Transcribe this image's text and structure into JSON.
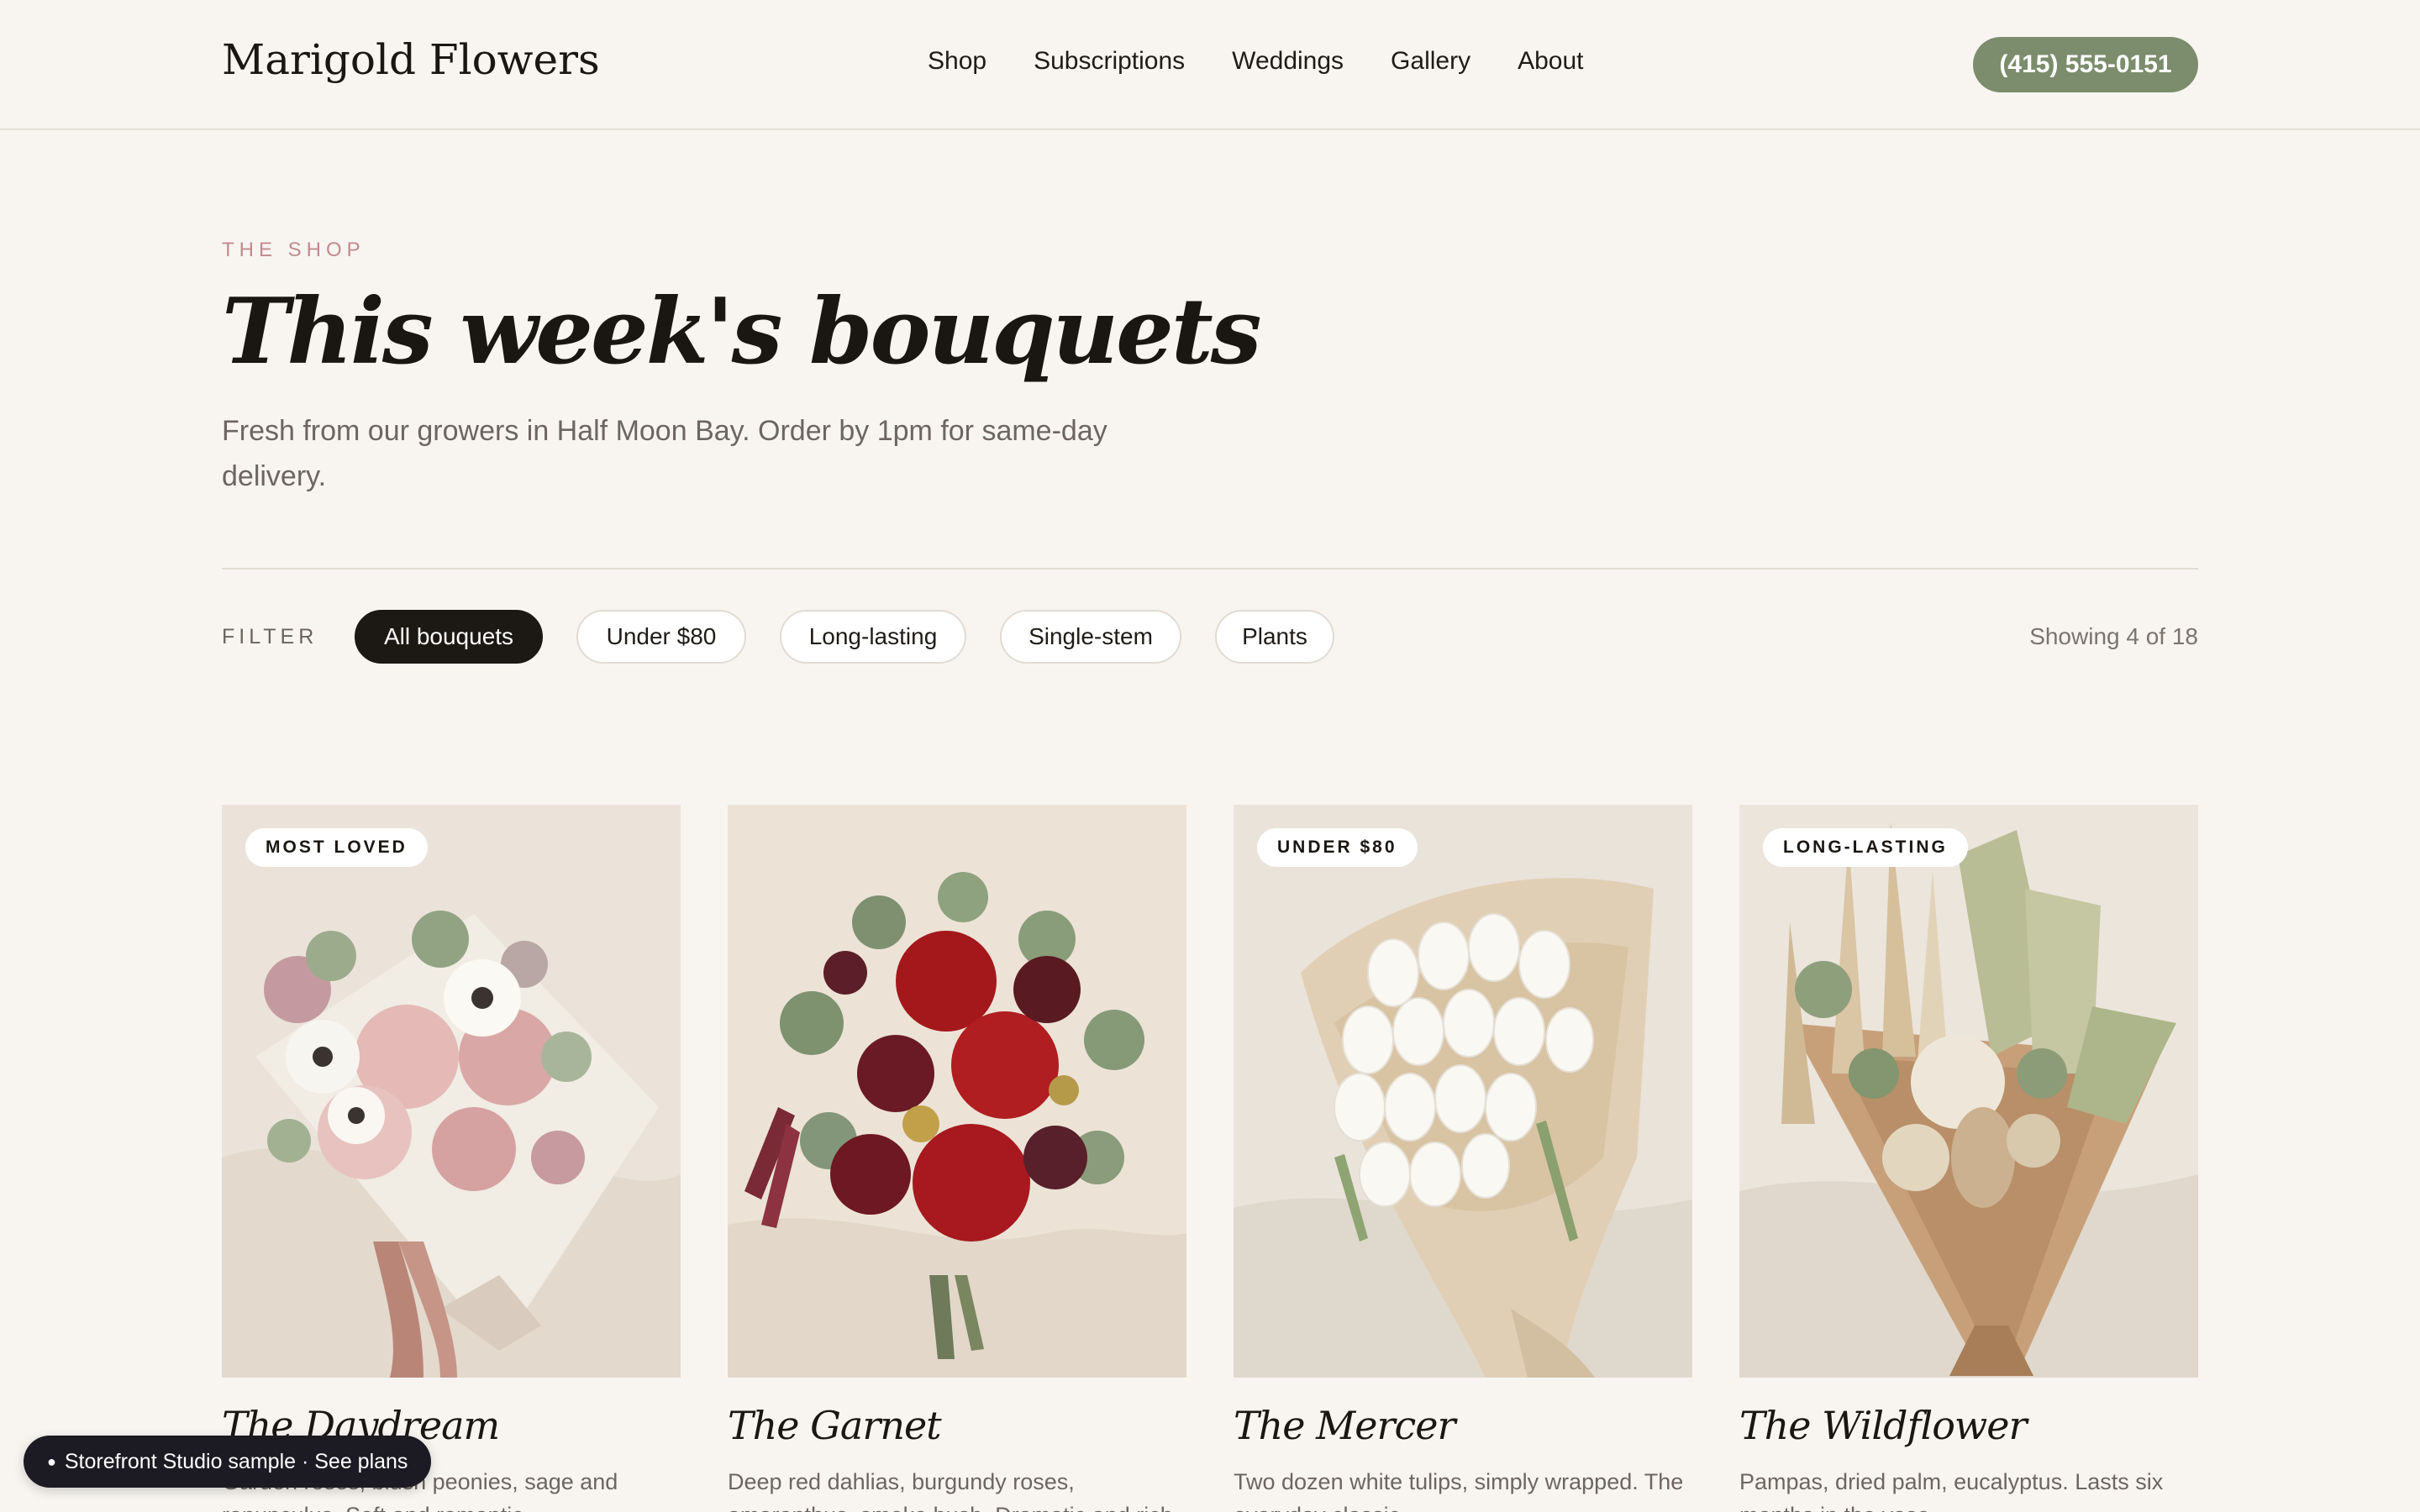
{
  "header": {
    "logo": "Marigold Flowers",
    "nav": [
      "Shop",
      "Subscriptions",
      "Weddings",
      "Gallery",
      "About"
    ],
    "phone": "(415) 555-0151"
  },
  "hero": {
    "eyebrow": "THE SHOP",
    "title": "This week's bouquets",
    "subtitle": "Fresh from our growers in Half Moon Bay. Order by 1pm for same-day delivery."
  },
  "filters": {
    "label": "FILTER",
    "chips": [
      "All bouquets",
      "Under $80",
      "Long-lasting",
      "Single-stem",
      "Plants"
    ],
    "active": "All bouquets",
    "count": "Showing 4 of 18"
  },
  "products": [
    {
      "badge": "MOST LOVED",
      "name": "The Daydream",
      "description": "Garden roses, blush peonies, sage and ranunculus. Soft and romantic."
    },
    {
      "badge": "",
      "name": "The Garnet",
      "description": "Deep red dahlias, burgundy roses, amaranthus, smoke bush. Dramatic and rich."
    },
    {
      "badge": "UNDER $80",
      "name": "The Mercer",
      "description": "Two dozen white tulips, simply wrapped. The everyday classic."
    },
    {
      "badge": "LONG-LASTING",
      "name": "The Wildflower",
      "description": "Pampas, dried palm, eucalyptus. Lasts six months in the vase."
    }
  ],
  "colors": {
    "background": "#f8f5f1",
    "accent": "#7b8d6c",
    "eyebrow": "#c28a8c",
    "ink": "#1a1612",
    "chip_active": "#1c1814"
  },
  "footer_pill": {
    "dot": "●",
    "text": "Storefront Studio sample · See plans"
  }
}
